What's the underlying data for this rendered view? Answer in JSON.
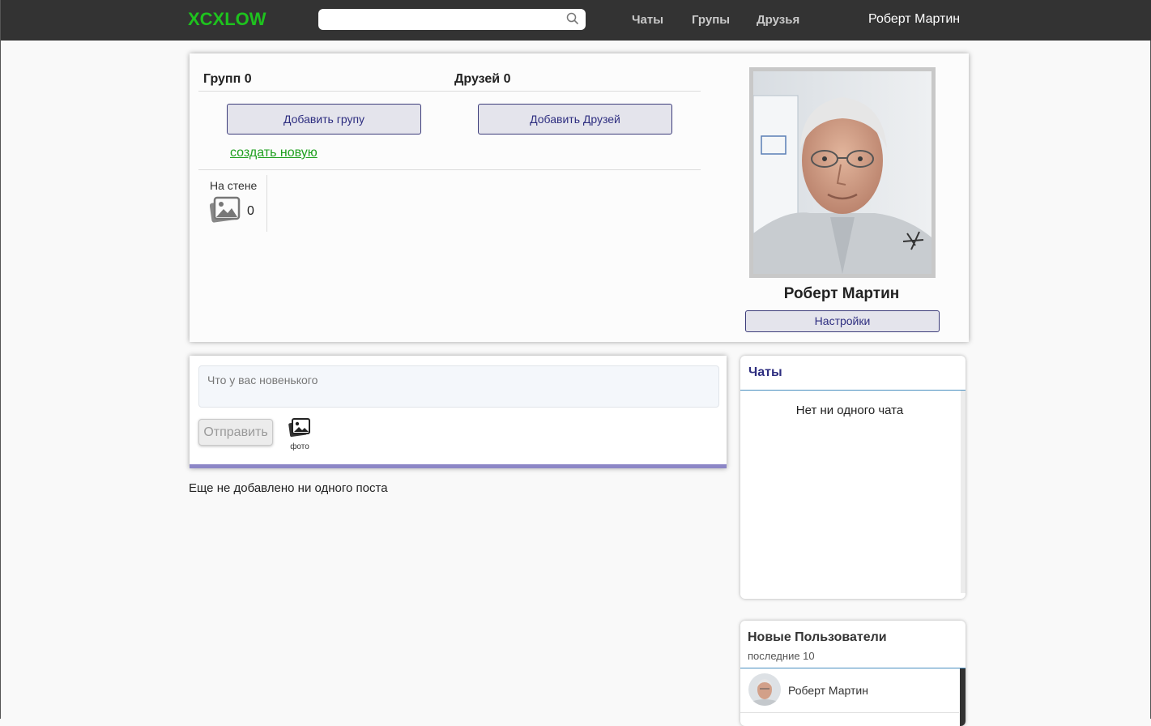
{
  "topbar": {
    "logo": "XCXLOW",
    "search_placeholder": "",
    "nav": [
      "Чаты",
      "Групы",
      "Друзья"
    ],
    "user_name": "Роберт Мартин"
  },
  "profile": {
    "groups_label": "Групп 0",
    "friends_label": "Друзей 0",
    "add_group_button": "Добавить групу",
    "add_friends_button": "Добавить Друзей",
    "create_new_link": "создать новую",
    "wall_label": "На стене",
    "wall_count": "0",
    "name": "Роберт Мартин",
    "settings_button": "Настройки"
  },
  "post": {
    "placeholder": "Что у вас новенького",
    "send_button": "Отправить",
    "photo_label": "фото",
    "empty_text": "Еще не добавлено ни одного поста"
  },
  "chats": {
    "title": "Чаты",
    "empty_text": "Нет ни одного чата"
  },
  "new_users": {
    "title": "Новые Пользователи",
    "subtitle": "последние 10",
    "users": [
      {
        "name": "Роберт Мартин"
      }
    ]
  },
  "colors": {
    "topbar": "#333333",
    "logo": "#1ec21e",
    "link_green": "#1ea01e",
    "button_text": "#2e2e80",
    "accent_bar": "#8c86c6"
  }
}
